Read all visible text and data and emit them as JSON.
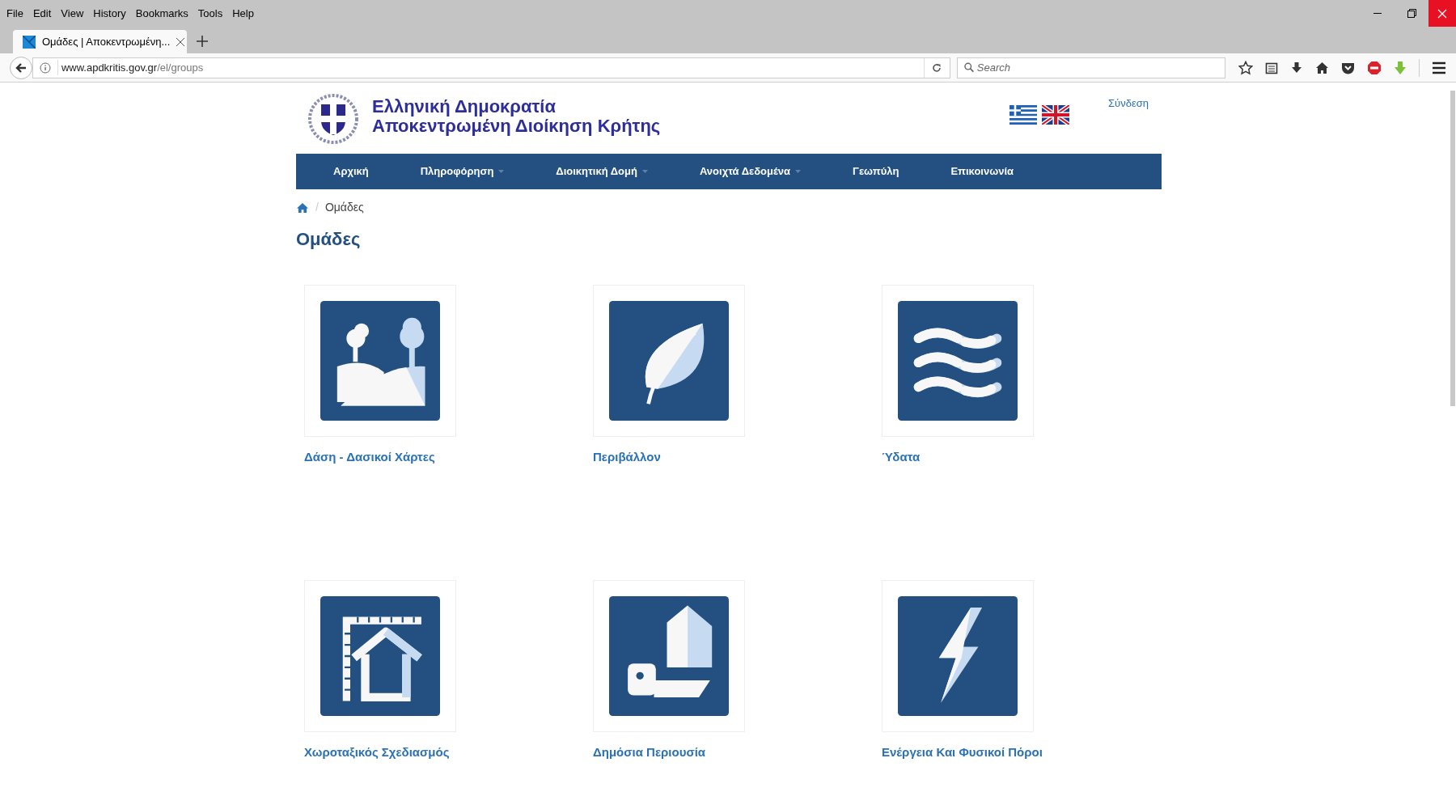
{
  "browser": {
    "menu": [
      "File",
      "Edit",
      "View",
      "History",
      "Bookmarks",
      "Tools",
      "Help"
    ],
    "tabs": [
      {
        "title": "Ομάδες | Αποκεντρωμένη...",
        "selected": true
      }
    ],
    "url": {
      "host": "www.apdkritis.gov.gr",
      "path": "/el/groups"
    },
    "search": {
      "placeholder": "Search"
    }
  },
  "site": {
    "title": "Ελληνική Δημοκρατία",
    "subtitle": "Αποκεντρωμένη Διοίκηση Κρήτης",
    "login": "Σύνδεση"
  },
  "nav": [
    {
      "label": "Αρχική",
      "dropdown": false
    },
    {
      "label": "Πληροφόρηση",
      "dropdown": true
    },
    {
      "label": "Διοικητική Δομή",
      "dropdown": true
    },
    {
      "label": "Ανοιχτά Δεδομένα",
      "dropdown": true
    },
    {
      "label": "Γεωπύλη",
      "dropdown": false
    },
    {
      "label": "Επικοινωνία",
      "dropdown": false
    }
  ],
  "breadcrumb": [
    {
      "separator": "/",
      "label": "Ομάδες"
    }
  ],
  "heading": "Ομάδες",
  "groups": [
    {
      "kind": "forest",
      "label": "Δάση - Δασικοί Χάρτες"
    },
    {
      "kind": "leaf",
      "label": "Περιβάλλον"
    },
    {
      "kind": "water",
      "label": "Ύδατα"
    },
    {
      "kind": "planning",
      "label": "Χωροταξικός Σχεδιασμός"
    },
    {
      "kind": "property",
      "label": "Δημόσια Περιουσία"
    },
    {
      "kind": "energy",
      "label": "Ενέργεια Και Φυσικοί Πόροι"
    }
  ]
}
